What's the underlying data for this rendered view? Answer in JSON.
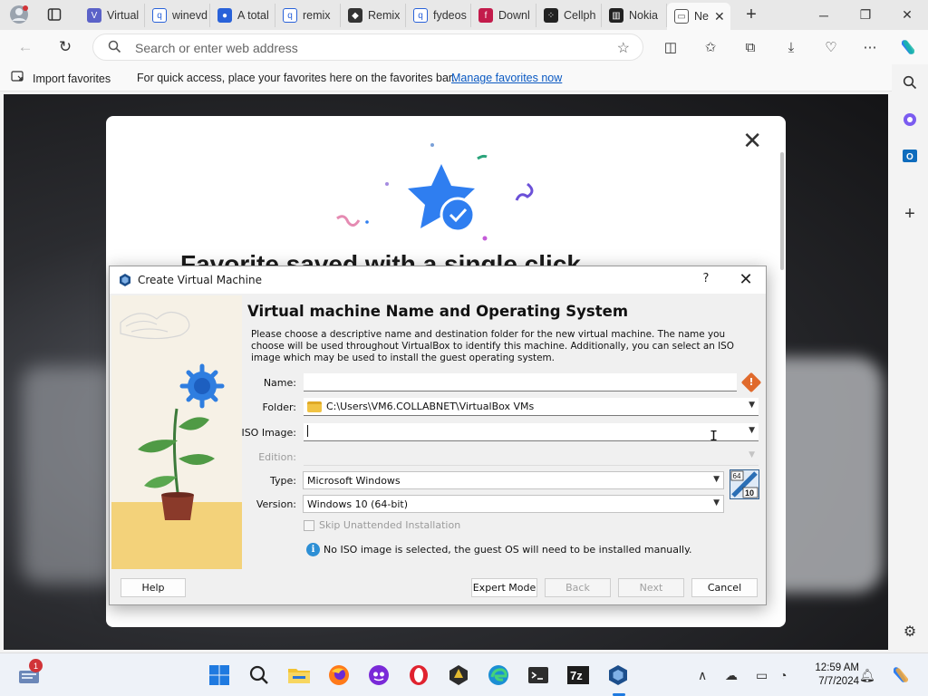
{
  "browser": {
    "tabs": [
      {
        "label": "Virtual",
        "favicon": "virtualbox-forum-icon",
        "color": "#5b62c8"
      },
      {
        "label": "winevd",
        "favicon": "search-icon",
        "color": "#2962d9"
      },
      {
        "label": "A total",
        "favicon": "users-icon",
        "color": "#2962d9"
      },
      {
        "label": "remix",
        "favicon": "search-icon",
        "color": "#2962d9"
      },
      {
        "label": "Remix",
        "favicon": "cube-icon",
        "color": "#333333"
      },
      {
        "label": "fydeos",
        "favicon": "search-icon",
        "color": "#2962d9"
      },
      {
        "label": "Downl",
        "favicon": "fydeos-icon",
        "color": "#c31b4b"
      },
      {
        "label": "Cellph",
        "favicon": "dots-icon",
        "color": "#222222"
      },
      {
        "label": "Nokia",
        "favicon": "building-icon",
        "color": "#222222"
      },
      {
        "label": "Ne",
        "favicon": "newtab-icon",
        "color": "#555555"
      }
    ],
    "address": {
      "placeholder": "Search or enter web address"
    },
    "favorites_bar": {
      "import_label": "Import favorites",
      "message": "For quick access, place your favorites here on the favorites bar.",
      "link": "Manage favorites now"
    }
  },
  "modal": {
    "heading": "Favorite saved with a single click"
  },
  "dialog": {
    "title": "Create Virtual Machine",
    "help_glyph": "?",
    "heading": "Virtual machine Name and Operating System",
    "description": "Please choose a descriptive name and destination folder for the new virtual machine. The name you choose will be used throughout VirtualBox to identify this machine. Additionally, you can select an ISO image which may be used to install the guest operating system.",
    "fields": {
      "name": {
        "label": "Name:",
        "value": ""
      },
      "folder": {
        "label": "Folder:",
        "value": "C:\\Users\\VM6.COLLABNET\\VirtualBox VMs"
      },
      "iso": {
        "label": "ISO Image:",
        "value": ""
      },
      "edition": {
        "label": "Edition:",
        "value": ""
      },
      "type": {
        "label": "Type:",
        "value": "Microsoft Windows"
      },
      "version": {
        "label": "Version:",
        "value": "Windows 10 (64-bit)"
      }
    },
    "os_badge_top": "64",
    "os_badge_bottom": "10",
    "skip_unattended": {
      "label": "Skip Unattended Installation",
      "checked": false
    },
    "info": "No ISO image is selected, the guest OS will need to be installed manually.",
    "buttons": {
      "help": "Help",
      "expert": "Expert Mode",
      "back": "Back",
      "next": "Next",
      "cancel": "Cancel"
    }
  },
  "taskbar": {
    "notification_count": "1",
    "clock_time": "12:59 AM",
    "clock_date": "7/7/2024",
    "apps": [
      {
        "name": "start-icon",
        "color": "#1f7ae0"
      },
      {
        "name": "search-icon",
        "color": "#222222"
      },
      {
        "name": "file-explorer-icon",
        "color": "#f2c230"
      },
      {
        "name": "firefox-icon",
        "color": "#ff6a2a"
      },
      {
        "name": "app-icon",
        "color": "#6c2ad8"
      },
      {
        "name": "opera-icon",
        "color": "#e0232f"
      },
      {
        "name": "game-icon",
        "color": "#2c2c2c"
      },
      {
        "name": "edge-icon",
        "color": "#1aa0d8"
      },
      {
        "name": "terminal-icon",
        "color": "#2d2d2d"
      },
      {
        "name": "7zip-icon",
        "color": "#1d1d1d"
      },
      {
        "name": "virtualbox-icon",
        "color": "#1d4f8c"
      }
    ]
  }
}
